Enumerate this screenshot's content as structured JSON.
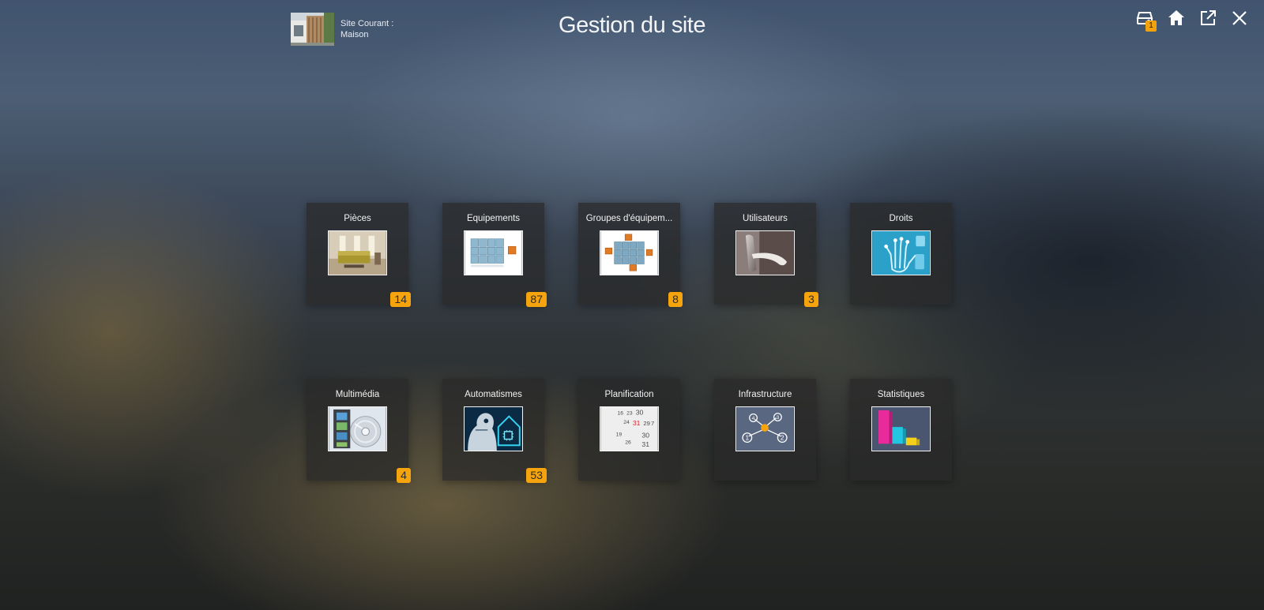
{
  "header": {
    "site_label": "Site Courant :",
    "site_name": "Maison",
    "title": "Gestion du site",
    "actions": [
      {
        "name": "drive",
        "icon": "drive-icon",
        "badge": "1"
      },
      {
        "name": "home",
        "icon": "home-icon"
      },
      {
        "name": "external",
        "icon": "external-link-icon"
      },
      {
        "name": "close",
        "icon": "close-icon"
      }
    ]
  },
  "tiles": [
    {
      "label": "Pièces",
      "badge": "14",
      "icon": "room-icon"
    },
    {
      "label": "Equipements",
      "badge": "87",
      "icon": "cubes-icon"
    },
    {
      "label": "Groupes d'équipem...",
      "badge": "8",
      "icon": "cube-group-icon"
    },
    {
      "label": "Utilisateurs",
      "badge": "3",
      "icon": "door-handle-icon"
    },
    {
      "label": "Droits",
      "badge": "",
      "icon": "hand-scan-icon"
    },
    {
      "label": "Multimédia",
      "badge": "4",
      "icon": "film-disc-icon"
    },
    {
      "label": "Automatismes",
      "badge": "53",
      "icon": "robot-house-icon"
    },
    {
      "label": "Planification",
      "badge": "",
      "icon": "calendar-icon"
    },
    {
      "label": "Infrastructure",
      "badge": "",
      "icon": "network-icon"
    },
    {
      "label": "Statistiques",
      "badge": "",
      "icon": "bar-chart-icon"
    }
  ],
  "calendar_numbers": [
    "16",
    "23",
    "30",
    "24",
    "31",
    "29",
    "7",
    "19",
    "26",
    "30",
    "31"
  ],
  "network_nodes": [
    "4",
    "3",
    "1",
    "2"
  ],
  "colors": {
    "badge": "#f5a40d",
    "tile_bg": "#282828"
  }
}
